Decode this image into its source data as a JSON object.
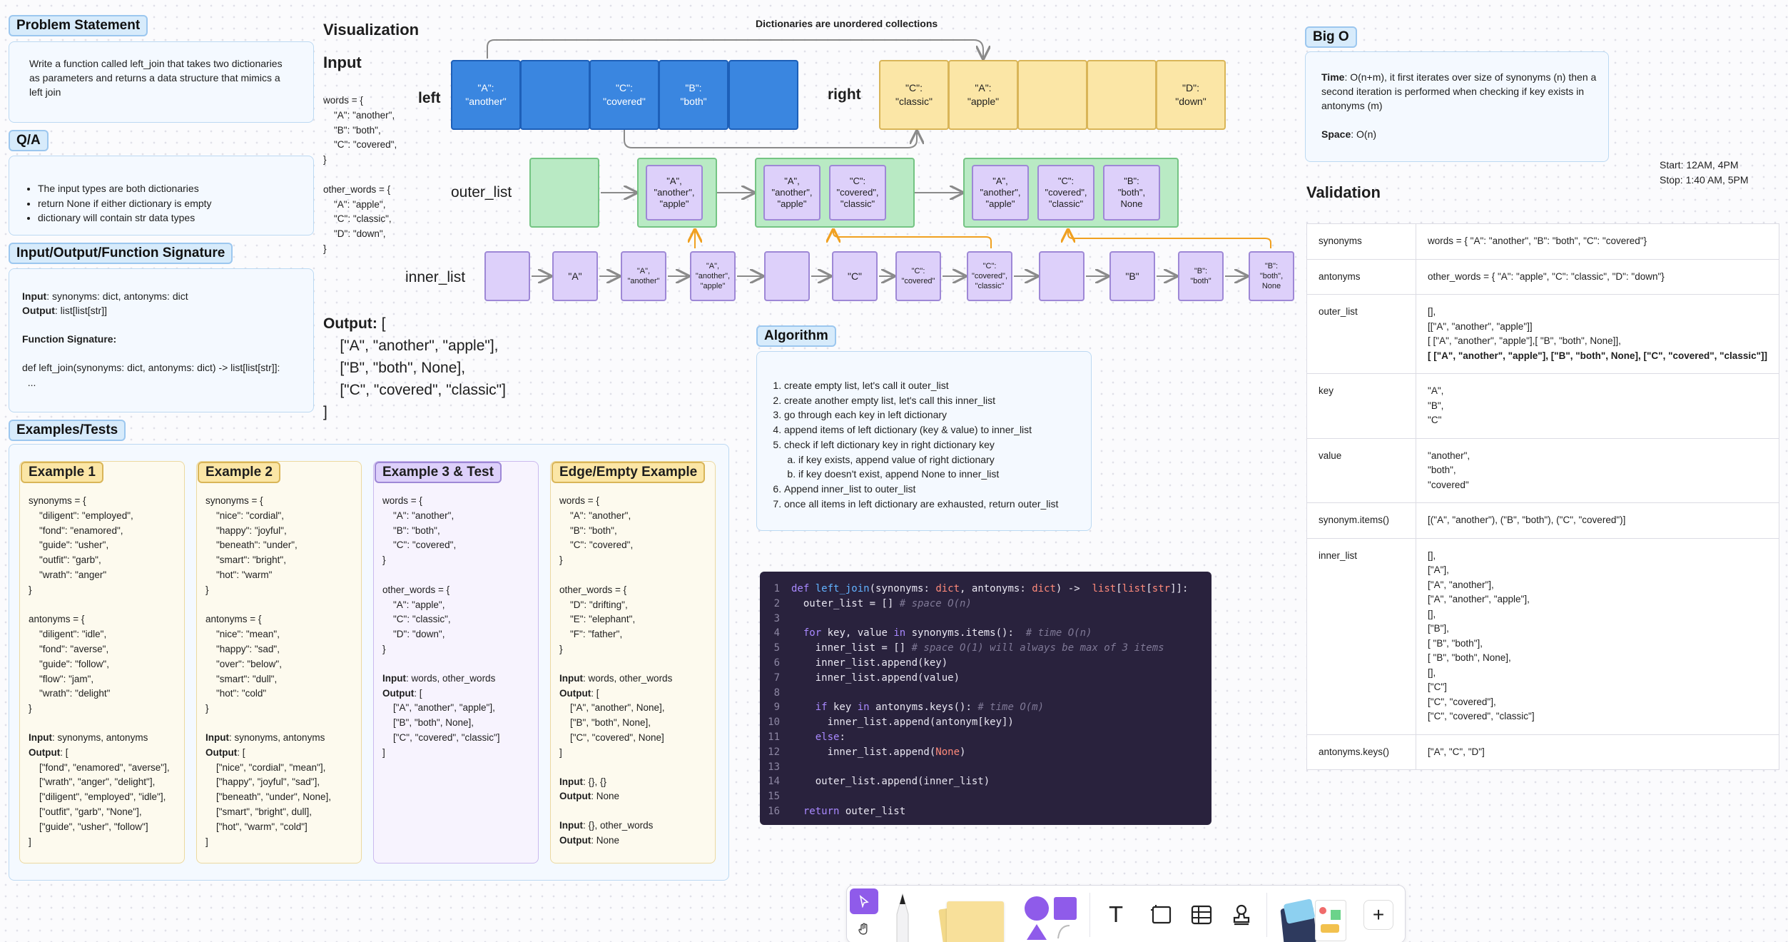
{
  "problem": {
    "tag": "Problem Statement",
    "text": "Write a function called left_join that takes two dictionaries as parameters and returns a data structure that mimics a left join"
  },
  "qa": {
    "tag": "Q/A",
    "items": [
      "The input types are both dictionaries",
      "return None if either dictionary is empty",
      "dictionary will contain str data types"
    ]
  },
  "io": {
    "tag": "Input/Output/Function Signature",
    "input_label": "Input",
    "input_value": ": synonyms: dict, antonyms: dict",
    "output_label": "Output",
    "output_value": ": list[list[str]]",
    "sig_label": "Function Signature:",
    "sig_code": "def left_join(synonyms: dict, antonyms: dict) -> list[list[str]]:\n  ..."
  },
  "examples": {
    "tag": "Examples/Tests",
    "cards": [
      {
        "title": "Example 1",
        "body": "synonyms = {\n    \"diligent\": \"employed\",\n    \"fond\": \"enamored\",\n    \"guide\": \"usher\",\n    \"outfit\": \"garb\",\n    \"wrath\": \"anger\"\n}\n\nantonyms = {\n    \"diligent\": \"idle\",\n    \"fond\": \"averse\",\n    \"guide\": \"follow\",\n    \"flow\": \"jam\",\n    \"wrath\": \"delight\"\n}",
        "input": "synonyms, antonyms",
        "output": "[\n    [\"fond\", \"enamored\", \"averse\"],\n    [\"wrath\", \"anger\", \"delight\"],\n    [\"diligent\", \"employed\", \"idle\"],\n    [\"outfit\", \"garb\", \"None\"],\n    [\"guide\", \"usher\", \"follow\"]\n]"
      },
      {
        "title": "Example 2",
        "body": "synonyms = {\n    \"nice\": \"cordial\",\n    \"happy\": \"joyful\",\n    \"beneath\": \"under\",\n    \"smart\": \"bright\",\n    \"hot\": \"warm\"\n}\n\nantonyms = {\n    \"nice\": \"mean\",\n    \"happy\": \"sad\",\n    \"over\": \"below\",\n    \"smart\": \"dull\",\n    \"hot\": \"cold\"\n}",
        "input": "synonyms, antonyms",
        "output": "[\n    [\"nice\", \"cordial\", \"mean\"],\n    [\"happy\", \"joyful\", \"sad\"],\n    [\"beneath\", \"under\", None],\n    [\"smart\", \"bright\", dull],\n    [\"hot\", \"warm\", \"cold\"]\n]"
      },
      {
        "title": "Example 3 & Test",
        "body": "words = {\n    \"A\": \"another\",\n    \"B\": \"both\",\n    \"C\": \"covered\",\n}\n\nother_words = {\n    \"A\": \"apple\",\n    \"C\": \"classic\",\n    \"D\": \"down\",\n}",
        "input": "words, other_words",
        "output": "[\n    [\"A\", \"another\", \"apple\"],\n    [\"B\", \"both\", None],\n    [\"C\", \"covered\", \"classic\"]\n]"
      },
      {
        "title": "Edge/Empty Example",
        "body": "words = {\n    \"A\": \"another\",\n    \"B\": \"both\",\n    \"C\": \"covered\",\n}\n\nother_words = {\n    \"D\": \"drifting\",\n    \"E\": \"elephant\",\n    \"F\": \"father\",\n}",
        "input": "words, other_words",
        "output": "[\n    [\"A\", \"another\", None],\n    [\"B\", \"both\", None],\n    [\"C\", \"covered\", None]\n]",
        "extra": [
          {
            "input": "{}, {}",
            "output": "None"
          },
          {
            "input": "{}, other_words",
            "output": "None"
          }
        ]
      }
    ],
    "input_label": "Input",
    "output_label": "Output"
  },
  "viz": {
    "title": "Visualization",
    "input_heading": "Input",
    "input_code": "words = {\n    \"A\": \"another\",\n    \"B\": \"both\",\n    \"C\": \"covered\",\n}\n\nother_words = {\n    \"A\": \"apple\",\n    \"C\": \"classic\",\n    \"D\": \"down\",\n}",
    "output_heading": "Output",
    "output_code": "[\n    [\"A\", \"another\", \"apple\"],\n    [\"B\", \"both\", None],\n    [\"C\", \"covered\", \"classic\"]\n]",
    "unordered_note": "Dictionaries are unordered collections",
    "left_label": "left",
    "right_label": "right",
    "outer_label": "outer_list",
    "inner_label": "inner_list",
    "left_boxes": [
      "\"A\":\n\"another\"",
      "",
      "\"C\":\n\"covered\"",
      "\"B\":\n\"both\"",
      ""
    ],
    "right_boxes": [
      "\"C\":\n\"classic\"",
      "\"A\":\n\"apple\"",
      "",
      "",
      "\"D\":\n\"down\""
    ],
    "outer_groups": [
      [],
      [
        "\"A\",\n\"another\",\n\"apple\""
      ],
      [
        "\"A\",\n\"another\",\n\"apple\"",
        "\"C\":\n\"covered\",\n\"classic\""
      ],
      [
        "\"A\",\n\"another\",\n\"apple\"",
        "\"C\":\n\"covered\",\n\"classic\"",
        "\"B\":\n\"both\",\nNone"
      ]
    ],
    "inner_boxes": [
      "",
      "\"A\"",
      "\"A\",\n\"another\"",
      "\"A\",\n\"another\",\n\"apple\"",
      "",
      "\"C\"",
      "\"C\":\n\"covered\"",
      "\"C\":\n\"covered\",\n\"classic\"",
      "",
      "\"B\"",
      "\"B\":\n\"both\"",
      "\"B\":\n\"both\",\nNone"
    ]
  },
  "algorithm": {
    "tag": "Algorithm",
    "steps": [
      "create empty list, let's call it outer_list",
      "create another empty list, let's call this inner_list",
      "go through each key in left dictionary",
      "append items of left dictionary (key & value) to inner_list",
      "check if left dictionary key in right dictionary key"
    ],
    "substeps": [
      "if key exists, append value of right dictionary",
      "if key doesn't exist, append None to inner_list"
    ],
    "steps_after": [
      "Append inner_list to outer_list",
      "once all items in left dictionary are exhausted, return outer_list"
    ]
  },
  "code": {
    "lines": [
      "def left_join(synonyms: dict, antonyms: dict) ->  list[list[str]]:",
      "  outer_list = [] # space O(n)",
      "",
      "  for key, value in synonyms.items():  # time O(n)",
      "    inner_list = [] # space O(1) will always be max of 3 items",
      "    inner_list.append(key)",
      "    inner_list.append(value)",
      "",
      "    if key in antonyms.keys(): # time O(m)",
      "      inner_list.append(antonym[key])",
      "    else:",
      "      inner_list.append(None)",
      "",
      "    outer_list.append(inner_list)",
      "",
      "  return outer_list"
    ]
  },
  "bigo": {
    "tag": "Big O",
    "time_label": "Time",
    "time_text": ": O(n+m), it first iterates over size of synonyms (n) then a second iteration is performed when checking if key exists in antonyms (m)",
    "space_label": "Space",
    "space_text": ": O(n)"
  },
  "times": {
    "start": "Start: 12AM, 4PM",
    "stop": "Stop: 1:40 AM, 5PM"
  },
  "validation": {
    "title": "Validation",
    "rows": [
      {
        "key": "synonyms",
        "value": "words = { \"A\": \"another\", \"B\": \"both\", \"C\": \"covered\"}"
      },
      {
        "key": "antonyms",
        "value": "other_words = { \"A\": \"apple\", \"C\": \"classic\", \"D\": \"down\"}"
      },
      {
        "key": "outer_list",
        "value": "[],\n[[\"A\", \"another\", \"apple\"]]\n[ [\"A\", \"another\", \"apple\"],[ \"B\", \"both\", None]],",
        "bold": "[ [\"A\", \"another\", \"apple\"], [\"B\", \"both\", None], [\"C\", \"covered\", \"classic\"]]"
      },
      {
        "key": "key",
        "value": "\"A\",\n\"B\",\n\"C\""
      },
      {
        "key": "value",
        "value": "\"another\",\n\"both\",\n\"covered\""
      },
      {
        "key": "synonym.items()",
        "value": "[(\"A\", \"another\"), (\"B\", \"both\"), (\"C\", \"covered\")]"
      },
      {
        "key": "inner_list",
        "value": "[],\n[\"A\"],\n[\"A\", \"another\"],\n[\"A\", \"another\", \"apple\"],\n[],\n[\"B\"],\n[ \"B\", \"both\"],\n[ \"B\", \"both\", None],\n[],\n[\"C\"]\n[\"C\", \"covered\"],\n[\"C\", \"covered\", \"classic\"]"
      },
      {
        "key": "antonyms.keys()",
        "value": "[\"A\", \"C\", \"D\"]"
      }
    ]
  },
  "toolbar": {
    "tools": [
      "select-tool",
      "hand-tool",
      "pen-tool",
      "sticky-note-tool",
      "shapes-tool",
      "text-tool",
      "frame-tool",
      "table-tool",
      "stamp-tool",
      "widgets-tool",
      "add-tool"
    ],
    "text_glyph": "T",
    "add_glyph": "+"
  }
}
